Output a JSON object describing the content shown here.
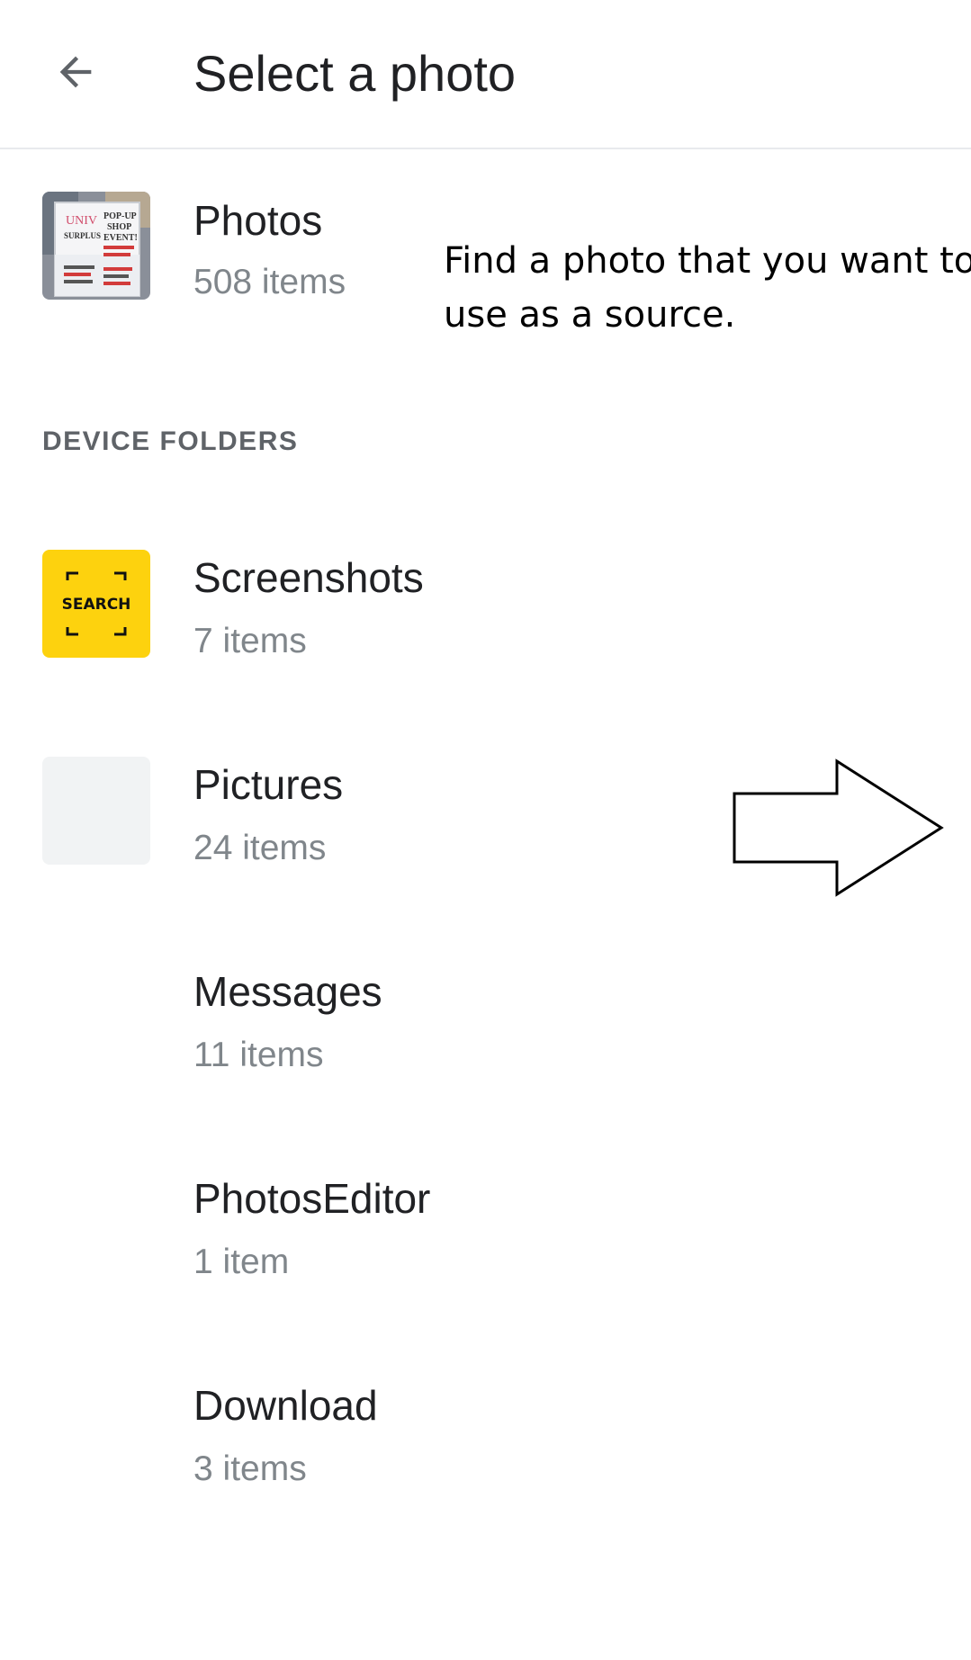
{
  "appbar": {
    "title": "Select a photo",
    "back_icon": "arrow-back-icon"
  },
  "primary": {
    "title": "Photos",
    "count": "508 items",
    "thumb_text": [
      "UNIV",
      "SURPLUS",
      "POP-UP",
      "SHOP",
      "EVENT!"
    ]
  },
  "section": {
    "label": "DEVICE FOLDERS"
  },
  "folders": [
    {
      "title": "Screenshots",
      "count": "7 items",
      "thumb": "search-logo",
      "thumb_text": "SEARCH"
    },
    {
      "title": "Pictures",
      "count": "24 items",
      "thumb": "empty"
    },
    {
      "title": "Messages",
      "count": "11 items",
      "thumb": "none"
    },
    {
      "title": "PhotosEditor",
      "count": "1 item",
      "thumb": "none"
    },
    {
      "title": "Download",
      "count": "3 items",
      "thumb": "none"
    }
  ],
  "annotation": {
    "line1": "Find a photo that you want to",
    "line2": "use as a source."
  },
  "colors": {
    "logo_yellow": "#fdd20e",
    "placeholder": "#f1f3f4",
    "secondary_text": "#80868b",
    "divider": "#e8eaed"
  }
}
